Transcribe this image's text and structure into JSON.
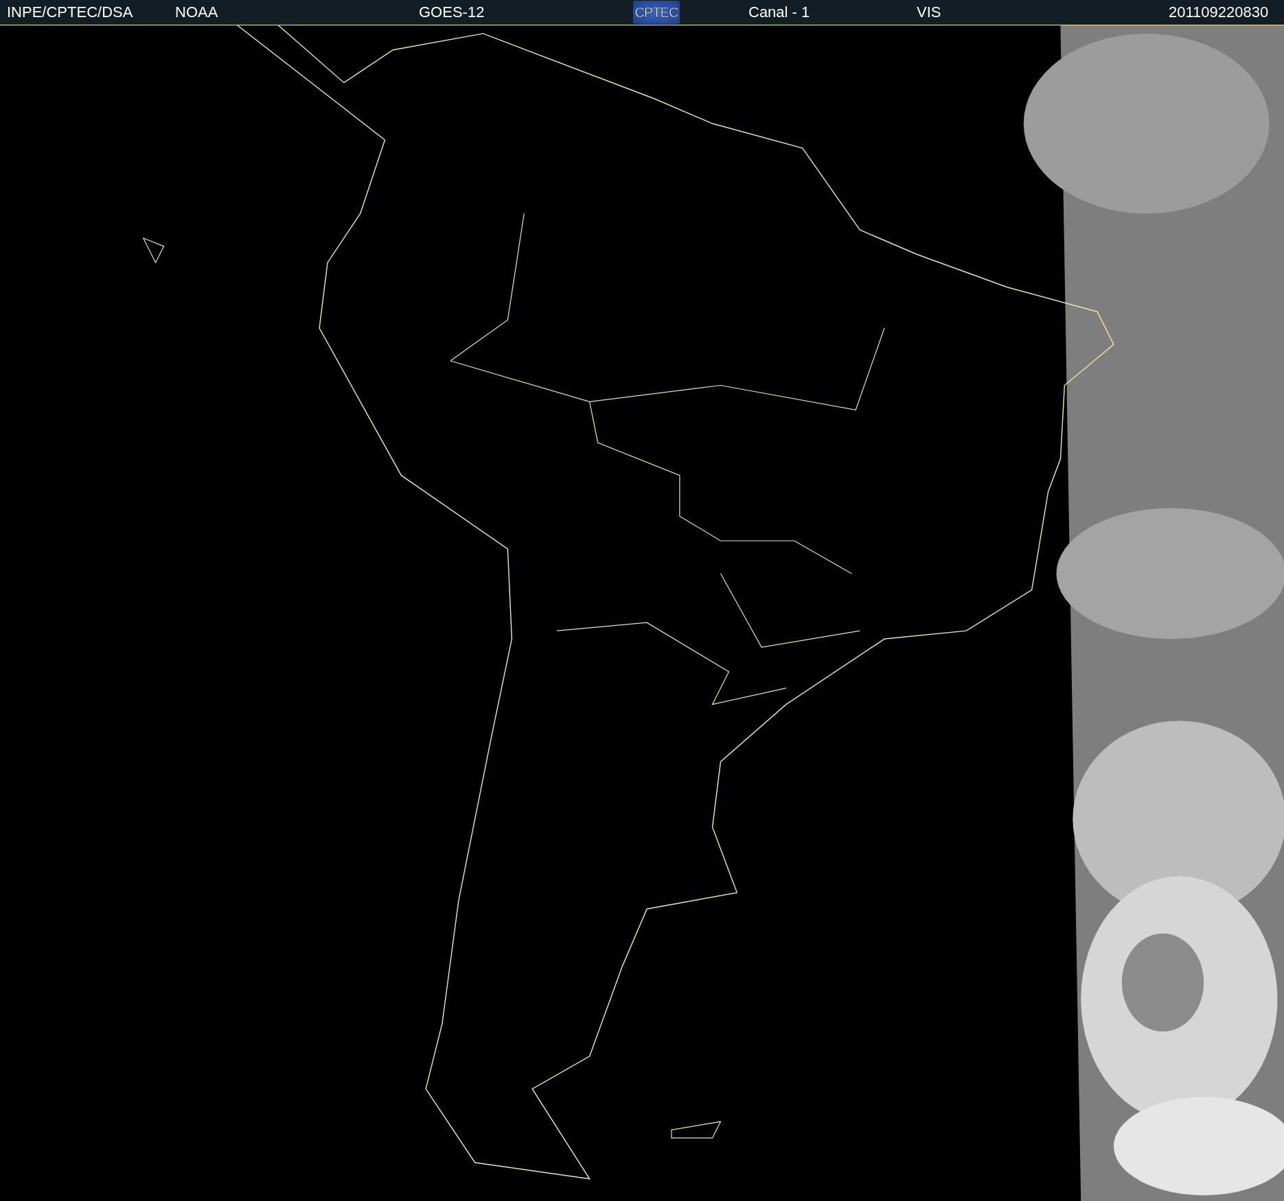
{
  "header": {
    "items": [
      {
        "kind": "text",
        "text": "INPE/CPTEC/DSA"
      },
      {
        "kind": "text",
        "text": "NOAA"
      },
      {
        "kind": "text",
        "text": "GOES-12"
      },
      {
        "kind": "logo",
        "text": "CPTEC"
      },
      {
        "kind": "text",
        "text": "Canal - 1"
      },
      {
        "kind": "text",
        "text": "VIS"
      },
      {
        "kind": "text",
        "text": "201109220830"
      }
    ]
  }
}
